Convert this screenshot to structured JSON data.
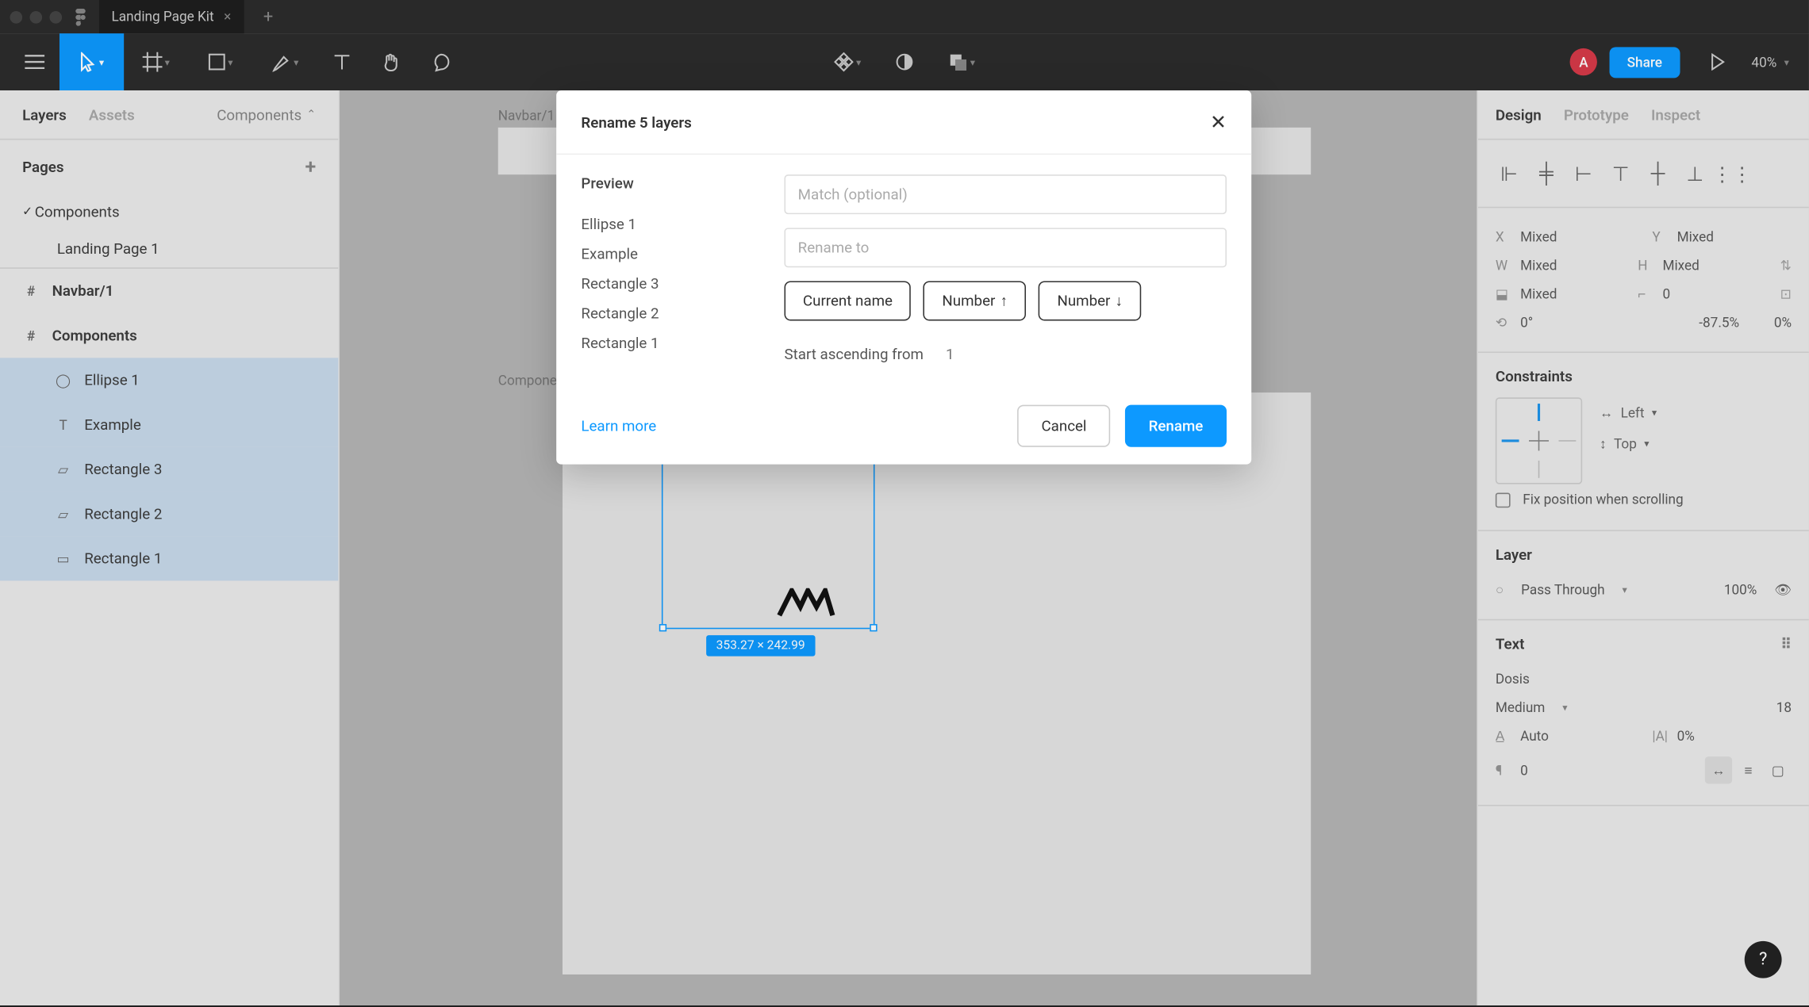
{
  "titlebar": {
    "tab": "Landing Page Kit"
  },
  "toolbar": {
    "avatar": "A",
    "share": "Share",
    "zoom": "40%"
  },
  "left_panel": {
    "tabs": {
      "layers": "Layers",
      "assets": "Assets",
      "components": "Components"
    },
    "pages_header": "Pages",
    "pages": [
      "Components",
      "Landing Page 1"
    ],
    "layers": [
      {
        "name": "Navbar/1",
        "icon": "frame",
        "bold": true
      },
      {
        "name": "Components",
        "icon": "frame",
        "bold": true
      },
      {
        "name": "Ellipse 1",
        "icon": "ellipse",
        "sel": true,
        "indent": true
      },
      {
        "name": "Example",
        "icon": "text",
        "sel": true,
        "indent": true
      },
      {
        "name": "Rectangle 3",
        "icon": "vector",
        "sel": true,
        "indent": true
      },
      {
        "name": "Rectangle 2",
        "icon": "vector",
        "sel": true,
        "indent": true
      },
      {
        "name": "Rectangle 1",
        "icon": "rect",
        "sel": true,
        "indent": true
      }
    ]
  },
  "canvas": {
    "frame1_label": "Navbar/1",
    "frame2_label": "Components",
    "dim": "353.27 × 242.99"
  },
  "right_panel": {
    "tabs": {
      "design": "Design",
      "prototype": "Prototype",
      "inspect": "Inspect"
    },
    "x": "Mixed",
    "y": "Mixed",
    "w": "Mixed",
    "h": "Mixed",
    "angle_row_l": "Mixed",
    "angle_row_r": "0",
    "rotation": "0°",
    "skew": "-87.5%",
    "scale": "0%",
    "constraints_title": "Constraints",
    "constraint_h": "Left",
    "constraint_v": "Top",
    "fix_label": "Fix position when scrolling",
    "layer_title": "Layer",
    "blend": "Pass Through",
    "opacity": "100%",
    "text_title": "Text",
    "font": "Dosis",
    "weight": "Medium",
    "size": "18",
    "line_height": "Auto",
    "letter_spacing": "0%",
    "paragraph": "0"
  },
  "modal": {
    "title": "Rename 5 layers",
    "preview_label": "Preview",
    "preview_items": [
      "Ellipse 1",
      "Example",
      "Rectangle 3",
      "Rectangle 2",
      "Rectangle 1"
    ],
    "match_placeholder": "Match (optional)",
    "rename_placeholder": "Rename to",
    "pill_current": "Current name",
    "pill_num_up": "Number",
    "pill_num_down": "Number",
    "asc_label": "Start ascending from",
    "asc_value": "1",
    "learn": "Learn more",
    "cancel": "Cancel",
    "rename": "Rename"
  },
  "help": "?"
}
